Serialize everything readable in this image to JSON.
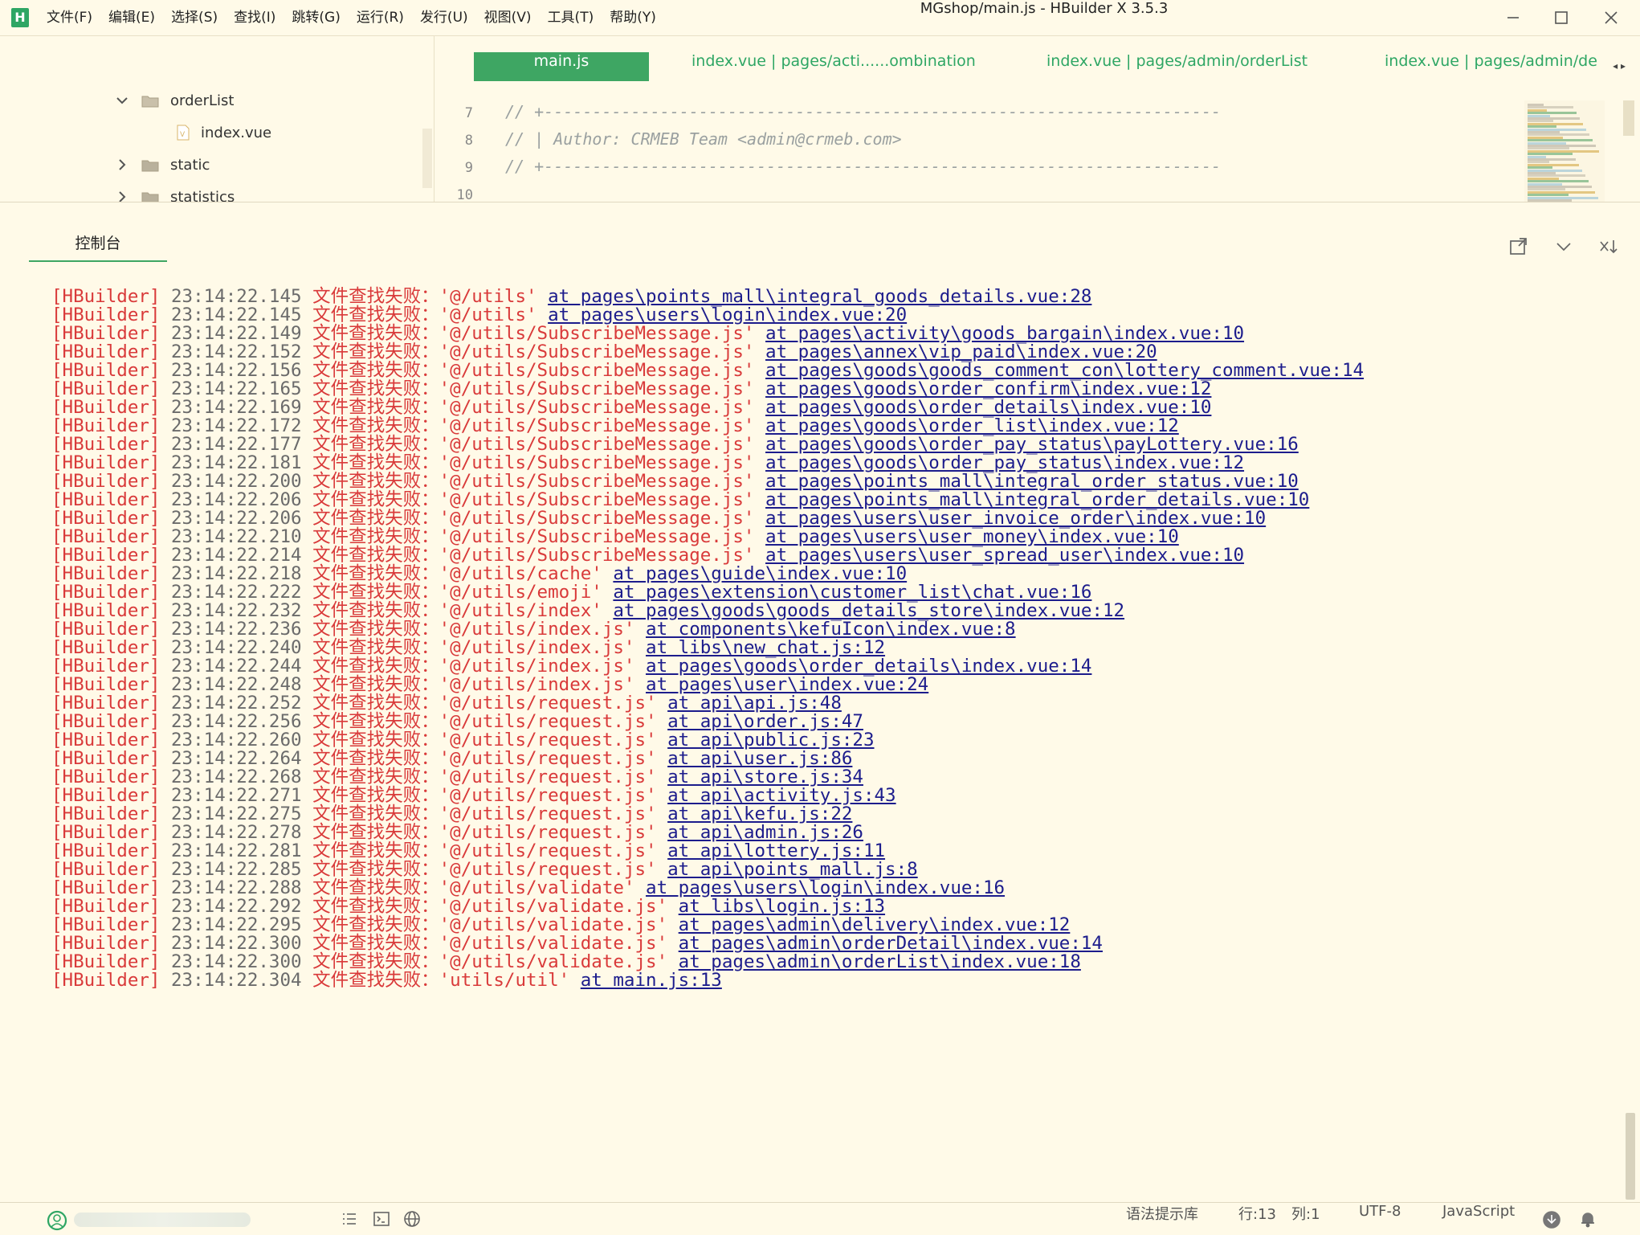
{
  "app": {
    "logo": "H",
    "window_title": "MGshop/main.js - HBuilder X 3.5.3"
  },
  "menu": [
    "文件(F)",
    "编辑(E)",
    "选择(S)",
    "查找(I)",
    "跳转(G)",
    "运行(R)",
    "发行(U)",
    "视图(V)",
    "工具(T)",
    "帮助(Y)"
  ],
  "file_tree": [
    {
      "label": "orderList",
      "type": "folder",
      "expanded": true,
      "level": 1
    },
    {
      "label": "index.vue",
      "type": "file",
      "level": 2
    },
    {
      "label": "static",
      "type": "folder",
      "expanded": false,
      "level": 1
    },
    {
      "label": "statistics",
      "type": "folder",
      "expanded": false,
      "level": 1
    }
  ],
  "tabs": [
    {
      "label": "main.js",
      "active": true
    },
    {
      "label": "index.vue | pages/acti......ombination",
      "active": false
    },
    {
      "label": "index.vue | pages/admin/orderList",
      "active": false
    },
    {
      "label": "index.vue | pages/admin/de",
      "active": false
    }
  ],
  "tab_nav": "◂ ▸",
  "code_lines": [
    {
      "num": "7",
      "text": "// +----------------------------------------------------------------------"
    },
    {
      "num": "8",
      "text": "// | Author: CRMEB Team <admin@crmeb.com>"
    },
    {
      "num": "9",
      "text": "// +----------------------------------------------------------------------"
    },
    {
      "num": "10",
      "text": ""
    }
  ],
  "console": {
    "tab_label": "控制台",
    "lines": [
      {
        "tag": "[HBuilder]",
        "time": "23:14:22.145",
        "msg": "文件查找失败：",
        "path": "'@/utils'",
        "loc": "at pages\\points_mall\\integral_goods_details.vue:28"
      },
      {
        "tag": "[HBuilder]",
        "time": "23:14:22.145",
        "msg": "文件查找失败：",
        "path": "'@/utils'",
        "loc": "at pages\\users\\login\\index.vue:20"
      },
      {
        "tag": "[HBuilder]",
        "time": "23:14:22.149",
        "msg": "文件查找失败：",
        "path": "'@/utils/SubscribeMessage.js'",
        "loc": "at pages\\activity\\goods_bargain\\index.vue:10"
      },
      {
        "tag": "[HBuilder]",
        "time": "23:14:22.152",
        "msg": "文件查找失败：",
        "path": "'@/utils/SubscribeMessage.js'",
        "loc": "at pages\\annex\\vip_paid\\index.vue:20"
      },
      {
        "tag": "[HBuilder]",
        "time": "23:14:22.156",
        "msg": "文件查找失败：",
        "path": "'@/utils/SubscribeMessage.js'",
        "loc": "at pages\\goods\\goods_comment_con\\lottery_comment.vue:14"
      },
      {
        "tag": "[HBuilder]",
        "time": "23:14:22.165",
        "msg": "文件查找失败：",
        "path": "'@/utils/SubscribeMessage.js'",
        "loc": "at pages\\goods\\order_confirm\\index.vue:12"
      },
      {
        "tag": "[HBuilder]",
        "time": "23:14:22.169",
        "msg": "文件查找失败：",
        "path": "'@/utils/SubscribeMessage.js'",
        "loc": "at pages\\goods\\order_details\\index.vue:10"
      },
      {
        "tag": "[HBuilder]",
        "time": "23:14:22.172",
        "msg": "文件查找失败：",
        "path": "'@/utils/SubscribeMessage.js'",
        "loc": "at pages\\goods\\order_list\\index.vue:12"
      },
      {
        "tag": "[HBuilder]",
        "time": "23:14:22.177",
        "msg": "文件查找失败：",
        "path": "'@/utils/SubscribeMessage.js'",
        "loc": "at pages\\goods\\order_pay_status\\payLottery.vue:16"
      },
      {
        "tag": "[HBuilder]",
        "time": "23:14:22.181",
        "msg": "文件查找失败：",
        "path": "'@/utils/SubscribeMessage.js'",
        "loc": "at pages\\goods\\order_pay_status\\index.vue:12"
      },
      {
        "tag": "[HBuilder]",
        "time": "23:14:22.200",
        "msg": "文件查找失败：",
        "path": "'@/utils/SubscribeMessage.js'",
        "loc": "at pages\\points_mall\\integral_order_status.vue:10"
      },
      {
        "tag": "[HBuilder]",
        "time": "23:14:22.206",
        "msg": "文件查找失败：",
        "path": "'@/utils/SubscribeMessage.js'",
        "loc": "at pages\\points_mall\\integral_order_details.vue:10"
      },
      {
        "tag": "[HBuilder]",
        "time": "23:14:22.206",
        "msg": "文件查找失败：",
        "path": "'@/utils/SubscribeMessage.js'",
        "loc": "at pages\\users\\user_invoice_order\\index.vue:10"
      },
      {
        "tag": "[HBuilder]",
        "time": "23:14:22.210",
        "msg": "文件查找失败：",
        "path": "'@/utils/SubscribeMessage.js'",
        "loc": "at pages\\users\\user_money\\index.vue:10"
      },
      {
        "tag": "[HBuilder]",
        "time": "23:14:22.214",
        "msg": "文件查找失败：",
        "path": "'@/utils/SubscribeMessage.js'",
        "loc": "at pages\\users\\user_spread_user\\index.vue:10"
      },
      {
        "tag": "[HBuilder]",
        "time": "23:14:22.218",
        "msg": "文件查找失败：",
        "path": "'@/utils/cache'",
        "loc": "at pages\\guide\\index.vue:10"
      },
      {
        "tag": "[HBuilder]",
        "time": "23:14:22.222",
        "msg": "文件查找失败：",
        "path": "'@/utils/emoji'",
        "loc": "at pages\\extension\\customer_list\\chat.vue:16"
      },
      {
        "tag": "[HBuilder]",
        "time": "23:14:22.232",
        "msg": "文件查找失败：",
        "path": "'@/utils/index'",
        "loc": "at pages\\goods\\goods_details_store\\index.vue:12"
      },
      {
        "tag": "[HBuilder]",
        "time": "23:14:22.236",
        "msg": "文件查找失败：",
        "path": "'@/utils/index.js'",
        "loc": "at components\\kefuIcon\\index.vue:8"
      },
      {
        "tag": "[HBuilder]",
        "time": "23:14:22.240",
        "msg": "文件查找失败：",
        "path": "'@/utils/index.js'",
        "loc": "at libs\\new_chat.js:12"
      },
      {
        "tag": "[HBuilder]",
        "time": "23:14:22.244",
        "msg": "文件查找失败：",
        "path": "'@/utils/index.js'",
        "loc": "at pages\\goods\\order_details\\index.vue:14"
      },
      {
        "tag": "[HBuilder]",
        "time": "23:14:22.248",
        "msg": "文件查找失败：",
        "path": "'@/utils/index.js'",
        "loc": "at pages\\user\\index.vue:24"
      },
      {
        "tag": "[HBuilder]",
        "time": "23:14:22.252",
        "msg": "文件查找失败：",
        "path": "'@/utils/request.js'",
        "loc": "at api\\api.js:48"
      },
      {
        "tag": "[HBuilder]",
        "time": "23:14:22.256",
        "msg": "文件查找失败：",
        "path": "'@/utils/request.js'",
        "loc": "at api\\order.js:47"
      },
      {
        "tag": "[HBuilder]",
        "time": "23:14:22.260",
        "msg": "文件查找失败：",
        "path": "'@/utils/request.js'",
        "loc": "at api\\public.js:23"
      },
      {
        "tag": "[HBuilder]",
        "time": "23:14:22.264",
        "msg": "文件查找失败：",
        "path": "'@/utils/request.js'",
        "loc": "at api\\user.js:86"
      },
      {
        "tag": "[HBuilder]",
        "time": "23:14:22.268",
        "msg": "文件查找失败：",
        "path": "'@/utils/request.js'",
        "loc": "at api\\store.js:34"
      },
      {
        "tag": "[HBuilder]",
        "time": "23:14:22.271",
        "msg": "文件查找失败：",
        "path": "'@/utils/request.js'",
        "loc": "at api\\activity.js:43"
      },
      {
        "tag": "[HBuilder]",
        "time": "23:14:22.275",
        "msg": "文件查找失败：",
        "path": "'@/utils/request.js'",
        "loc": "at api\\kefu.js:22"
      },
      {
        "tag": "[HBuilder]",
        "time": "23:14:22.278",
        "msg": "文件查找失败：",
        "path": "'@/utils/request.js'",
        "loc": "at api\\admin.js:26"
      },
      {
        "tag": "[HBuilder]",
        "time": "23:14:22.281",
        "msg": "文件查找失败：",
        "path": "'@/utils/request.js'",
        "loc": "at api\\lottery.js:11"
      },
      {
        "tag": "[HBuilder]",
        "time": "23:14:22.285",
        "msg": "文件查找失败：",
        "path": "'@/utils/request.js'",
        "loc": "at api\\points_mall.js:8"
      },
      {
        "tag": "[HBuilder]",
        "time": "23:14:22.288",
        "msg": "文件查找失败：",
        "path": "'@/utils/validate'",
        "loc": "at pages\\users\\login\\index.vue:16"
      },
      {
        "tag": "[HBuilder]",
        "time": "23:14:22.292",
        "msg": "文件查找失败：",
        "path": "'@/utils/validate.js'",
        "loc": "at libs\\login.js:13"
      },
      {
        "tag": "[HBuilder]",
        "time": "23:14:22.295",
        "msg": "文件查找失败：",
        "path": "'@/utils/validate.js'",
        "loc": "at pages\\admin\\delivery\\index.vue:12"
      },
      {
        "tag": "[HBuilder]",
        "time": "23:14:22.300",
        "msg": "文件查找失败：",
        "path": "'@/utils/validate.js'",
        "loc": "at pages\\admin\\orderDetail\\index.vue:14"
      },
      {
        "tag": "[HBuilder]",
        "time": "23:14:22.300",
        "msg": "文件查找失败：",
        "path": "'@/utils/validate.js'",
        "loc": "at pages\\admin\\orderList\\index.vue:18"
      },
      {
        "tag": "[HBuilder]",
        "time": "23:14:22.304",
        "msg": "文件查找失败：",
        "path": "'utils/util'",
        "loc": "at main.js:13"
      }
    ]
  },
  "statusbar": {
    "syntax_lib": "语法提示库",
    "row": "行:13",
    "col": "列:1",
    "encoding": "UTF-8",
    "language": "JavaScript"
  },
  "colors": {
    "accent": "#3ea663",
    "background": "#fffae8",
    "error_text": "#d93a3a",
    "link": "#1c1c8c"
  }
}
